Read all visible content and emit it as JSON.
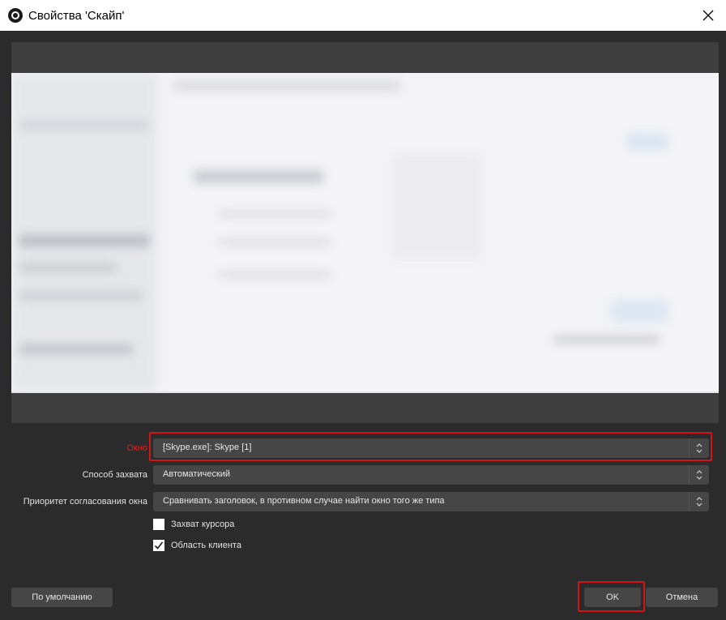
{
  "window": {
    "title": "Свойства 'Скайп'"
  },
  "form": {
    "window_label": "Окно",
    "window_value": "[Skype.exe]: Skype [1]",
    "capture_method_label": "Способ захвата",
    "capture_method_value": "Автоматический",
    "priority_label": "Приоритет согласования окна",
    "priority_value": "Сравнивать заголовок, в противном случае найти окно того же типа",
    "capture_cursor_label": "Захват курсора",
    "capture_cursor_checked": false,
    "client_area_label": "Область клиента",
    "client_area_checked": true
  },
  "buttons": {
    "defaults_label": "По умолчанию",
    "ok_label": "OK",
    "cancel_label": "Отмена"
  },
  "colors": {
    "background": "#2b2b2b",
    "control": "#464646",
    "highlight": "#d41414",
    "active_label": "#e52121"
  },
  "icons": {
    "app": "obs-icon",
    "close": "close-icon",
    "spin": "up-down-chevron-icon",
    "check": "checkmark-icon"
  }
}
